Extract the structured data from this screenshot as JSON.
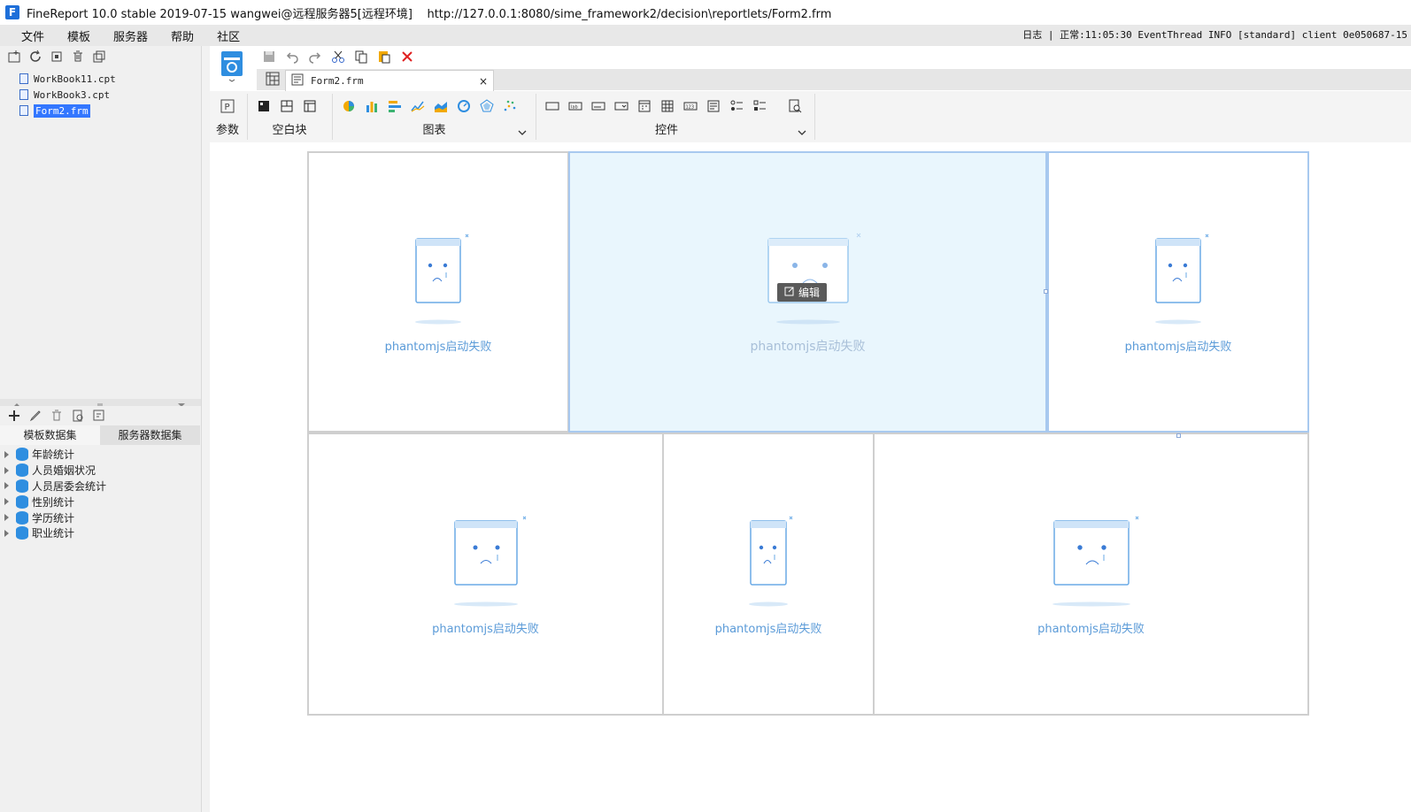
{
  "window": {
    "title": "FineReport 10.0 stable 2019-07-15 wangwei@远程服务器5[远程环境]    http://127.0.0.1:8080/sime_framework2/decision\\reportlets/Form2.frm"
  },
  "menubar": {
    "items": [
      "文件",
      "模板",
      "服务器",
      "帮助",
      "社区"
    ],
    "log_status": "日志 | 正常:11:05:30 EventThread INFO [standard] client 0e050687-15"
  },
  "file_tree": {
    "items": [
      {
        "label": "WorkBook11.cpt",
        "selected": false
      },
      {
        "label": "WorkBook3.cpt",
        "selected": false
      },
      {
        "label": "Form2.frm",
        "selected": true
      }
    ]
  },
  "datasets": {
    "tabs": [
      "模板数据集",
      "服务器数据集"
    ],
    "active_tab": "服务器数据集",
    "items": [
      "年龄统计",
      "人员婚姻状况",
      "人员居委会统计",
      "性别统计",
      "学历统计",
      "职业统计"
    ]
  },
  "document_tab": {
    "label": "Form2.frm",
    "close": "×"
  },
  "widget_groups": {
    "params": "参数",
    "blank": "空白块",
    "chart": "图表",
    "controls": "控件"
  },
  "cells": {
    "error_text": "phantomjs启动失败",
    "edit_label": "编辑"
  },
  "colors": {
    "accent": "#3377ff",
    "selection_bg": "#e9f6fd",
    "error_text": "#5b9bd8"
  }
}
